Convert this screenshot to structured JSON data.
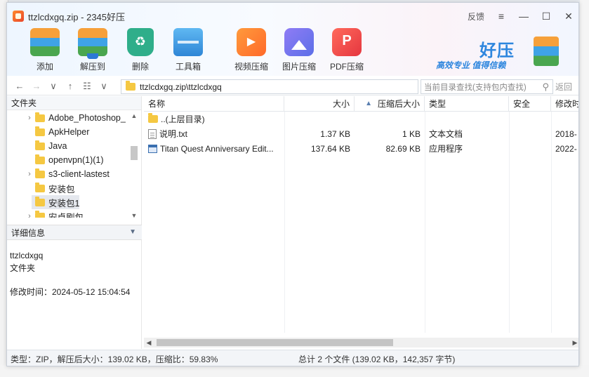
{
  "window": {
    "title": "ttzlcdxgq.zip - 2345好压",
    "controls": {
      "feedback": "反馈",
      "menu": "≡",
      "minimize": "—",
      "maximize": "☐",
      "close": "✕"
    }
  },
  "toolbar": {
    "add": "添加",
    "extract": "解压到",
    "delete": "删除",
    "toolbox": "工具箱",
    "video": "视频压缩",
    "image": "图片压缩",
    "pdf": "PDF压缩"
  },
  "brand": {
    "name": "好压",
    "slogan": "高效专业 值得信赖"
  },
  "address": {
    "path": "ttzlcdxgq.zip\\ttzlcdxgq",
    "search_placeholder": "当前目录查找(支持包内查找)",
    "return_label": "返回"
  },
  "tree": {
    "header": "文件夹",
    "items": [
      {
        "label": "Adobe_Photoshop_",
        "expandable": true
      },
      {
        "label": "ApkHelper",
        "expandable": false
      },
      {
        "label": "Java",
        "expandable": false
      },
      {
        "label": "openvpn(1)(1)",
        "expandable": false
      },
      {
        "label": "s3-client-lastest",
        "expandable": true
      },
      {
        "label": "安装包",
        "expandable": false
      },
      {
        "label": "安装包1",
        "expandable": false
      },
      {
        "label": "安卓刷包",
        "expandable": true
      }
    ]
  },
  "details": {
    "header": "详细信息",
    "name": "ttzlcdxgq",
    "kind": "文件夹",
    "modified": "修改时间：2024-05-12 15:04:54"
  },
  "filelist": {
    "columns": {
      "name": "名称",
      "size": "大小",
      "csize": "压缩后大小",
      "type": "类型",
      "safe": "安全",
      "modified": "修改时"
    },
    "rows": [
      {
        "name": "..(上层目录)",
        "size": "",
        "csize": "",
        "type": "",
        "safe": "",
        "modified": ""
      },
      {
        "name": "说明.txt",
        "size": "1.37 KB",
        "csize": "1 KB",
        "type": "文本文档",
        "safe": "",
        "modified": "2018-"
      },
      {
        "name": "Titan Quest Anniversary Edit...",
        "size": "137.64 KB",
        "csize": "82.69 KB",
        "type": "应用程序",
        "safe": "",
        "modified": "2022-"
      }
    ]
  },
  "status": {
    "left": "类型：ZIP，解压后大小：139.02 KB，压缩比：59.83%",
    "right": "总计 2 个文件 (139.02 KB，142,357 字节)"
  }
}
